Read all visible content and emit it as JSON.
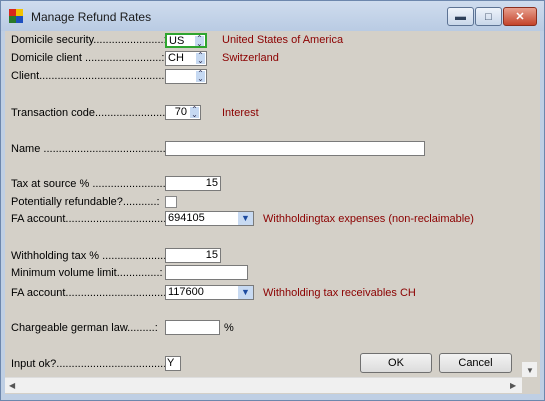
{
  "window": {
    "title": "Manage Refund Rates",
    "minimize_icon": "minimize-icon",
    "maximize_icon": "maximize-icon",
    "close_icon": "close-icon",
    "minimize_glyph": "▬",
    "maximize_glyph": "□",
    "close_glyph": "✕"
  },
  "form": {
    "domicile_security": {
      "label": "Domicile security.......................:",
      "value": "US",
      "description": "United States of America"
    },
    "domicile_client": {
      "label": "Domicile client .........................:",
      "value": "CH",
      "description": "Switzerland"
    },
    "client": {
      "label": "Client...........................................:",
      "value": ""
    },
    "transaction_code": {
      "label": "Transaction code.........................:",
      "value": "70",
      "description": "Interest"
    },
    "name": {
      "label": "Name ..................................................:",
      "value": ""
    },
    "tax_at_source": {
      "label": "Tax at source % .........................:",
      "value": "15"
    },
    "potentially_refundable": {
      "label": "Potentially refundable?...........:",
      "checked": false
    },
    "fa_account_1": {
      "label": "FA account...................................:",
      "value": "694105",
      "description": "Withholdingtax expenses (non-reclaimable)"
    },
    "withholding_tax": {
      "label": "Withholding tax % ......................:",
      "value": "15"
    },
    "minimum_volume_limit": {
      "label": "Minimum volume limit..............:",
      "value": ""
    },
    "fa_account_2": {
      "label": "FA account...................................:",
      "value": "117600",
      "description": "Withholding tax receivables CH"
    },
    "chargeable_german_law": {
      "label": "Chargeable german law.........:",
      "value": "",
      "unit": "%"
    },
    "input_ok": {
      "label": "Input ok?.......................................:",
      "value": "Y"
    }
  },
  "buttons": {
    "ok": "OK",
    "cancel": "Cancel"
  },
  "scroll": {
    "left_arrow": "◀",
    "right_arrow": "▶",
    "down_arrow": "▼"
  },
  "colors": {
    "description_text": "#8b0000",
    "window_frame": "#bfcfe4",
    "client_bg": "#d4d0c8"
  }
}
